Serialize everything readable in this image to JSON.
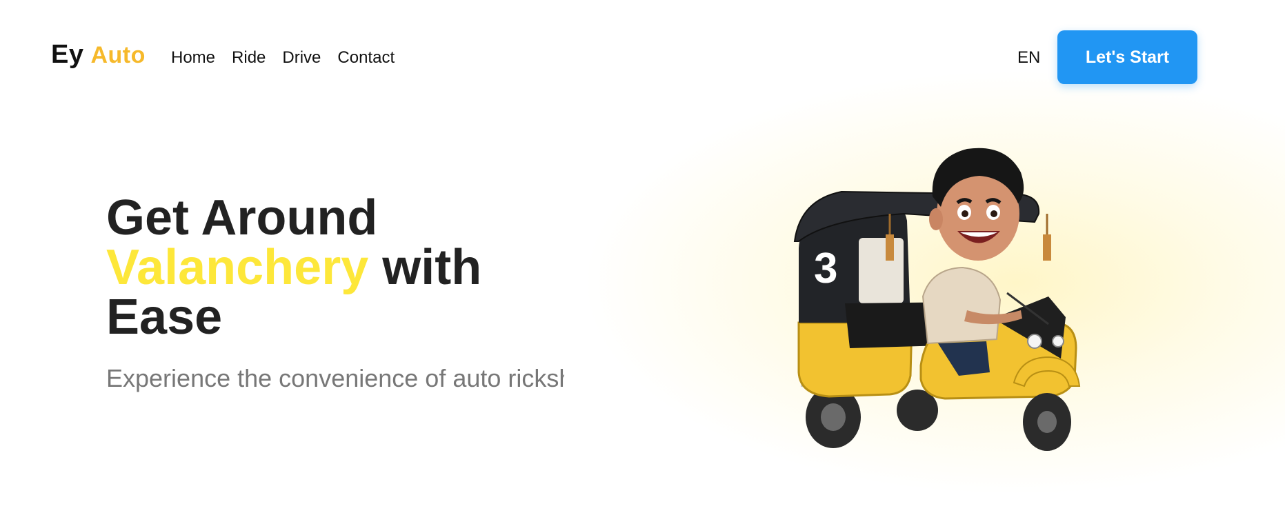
{
  "brand": {
    "part1": "Ey",
    "part2": "Auto"
  },
  "nav": {
    "items": [
      "Home",
      "Ride",
      "Drive",
      "Contact"
    ]
  },
  "header": {
    "language": "EN",
    "cta_label": "Let's Start"
  },
  "hero": {
    "title_line1": "Get Around",
    "title_highlight": "Valanchery",
    "title_after_highlight": " with",
    "title_line3": "Ease",
    "subtitle": "Experience the convenience of auto rickshaw rides in Valanchery"
  },
  "illustration": {
    "vehicle_number": "3"
  },
  "colors": {
    "accent_yellow": "#fde73a",
    "brand_yellow": "#f6b92b",
    "cta_blue": "#2196f3",
    "heading": "#222222",
    "muted_text": "#777777"
  }
}
